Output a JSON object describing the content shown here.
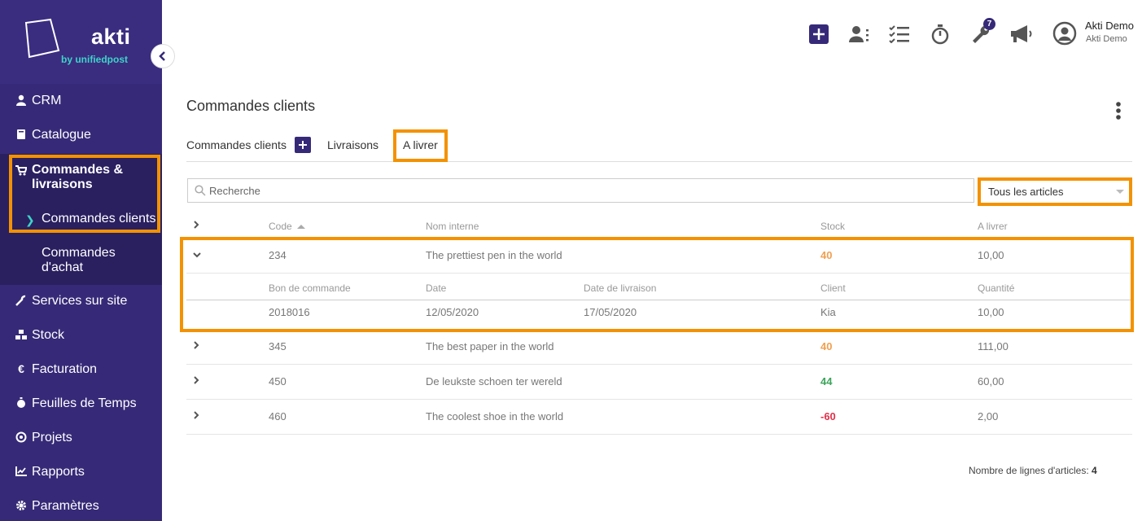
{
  "brand": {
    "name": "akti",
    "sub": "by unifiedpost"
  },
  "sidebar": {
    "items": [
      {
        "label": "CRM",
        "icon": "user-icon"
      },
      {
        "label": "Catalogue",
        "icon": "book-icon"
      },
      {
        "label": "Commandes &\nlivraisons",
        "icon": "cart-icon"
      },
      {
        "label": "Services sur site",
        "icon": "wrench-icon"
      },
      {
        "label": "Stock",
        "icon": "cubes-icon"
      },
      {
        "label": "Facturation",
        "icon": "euro-icon"
      },
      {
        "label": "Feuilles de Temps",
        "icon": "stopwatch-icon"
      },
      {
        "label": "Projets",
        "icon": "target-icon"
      },
      {
        "label": "Rapports",
        "icon": "chart-icon"
      },
      {
        "label": "Paramètres",
        "icon": "gear-icon"
      }
    ],
    "subitems": [
      {
        "label": "Commandes clients"
      },
      {
        "label": "Commandes\nd'achat"
      }
    ]
  },
  "topbar": {
    "badge_count": "7",
    "user_name": "Akti Demo",
    "user_org": "Akti Demo"
  },
  "page": {
    "title": "Commandes clients",
    "tabs": [
      {
        "label": "Commandes clients"
      },
      {
        "label": "Livraisons"
      },
      {
        "label": "A livrer"
      }
    ],
    "search_placeholder": "Recherche",
    "filter_value": "Tous les articles"
  },
  "table": {
    "headers": {
      "code": "Code",
      "name": "Nom interne",
      "stock": "Stock",
      "deliver": "A livrer"
    },
    "rows": [
      {
        "code": "234",
        "name": "The prettiest pen in the world",
        "stock": "40",
        "stock_color": "#f0a050",
        "deliver": "10,00"
      },
      {
        "code": "345",
        "name": "The best paper in the world",
        "stock": "40",
        "stock_color": "#f0a050",
        "deliver": "111,00"
      },
      {
        "code": "450",
        "name": "De leukste schoen ter wereld",
        "stock": "44",
        "stock_color": "#3aa55a",
        "deliver": "60,00"
      },
      {
        "code": "460",
        "name": "The coolest shoe in the world",
        "stock": "-60",
        "stock_color": "#e0314b",
        "deliver": "2,00"
      }
    ],
    "detail_headers": {
      "po": "Bon de commande",
      "date": "Date",
      "delivery_date": "Date de livraison",
      "client": "Client",
      "qty": "Quantité"
    },
    "detail_row": {
      "po": "2018016",
      "date": "12/05/2020",
      "delivery_date": "17/05/2020",
      "client": "Kia",
      "qty": "10,00"
    }
  },
  "footer": {
    "label": "Nombre de lignes d'articles:",
    "count": "4"
  }
}
